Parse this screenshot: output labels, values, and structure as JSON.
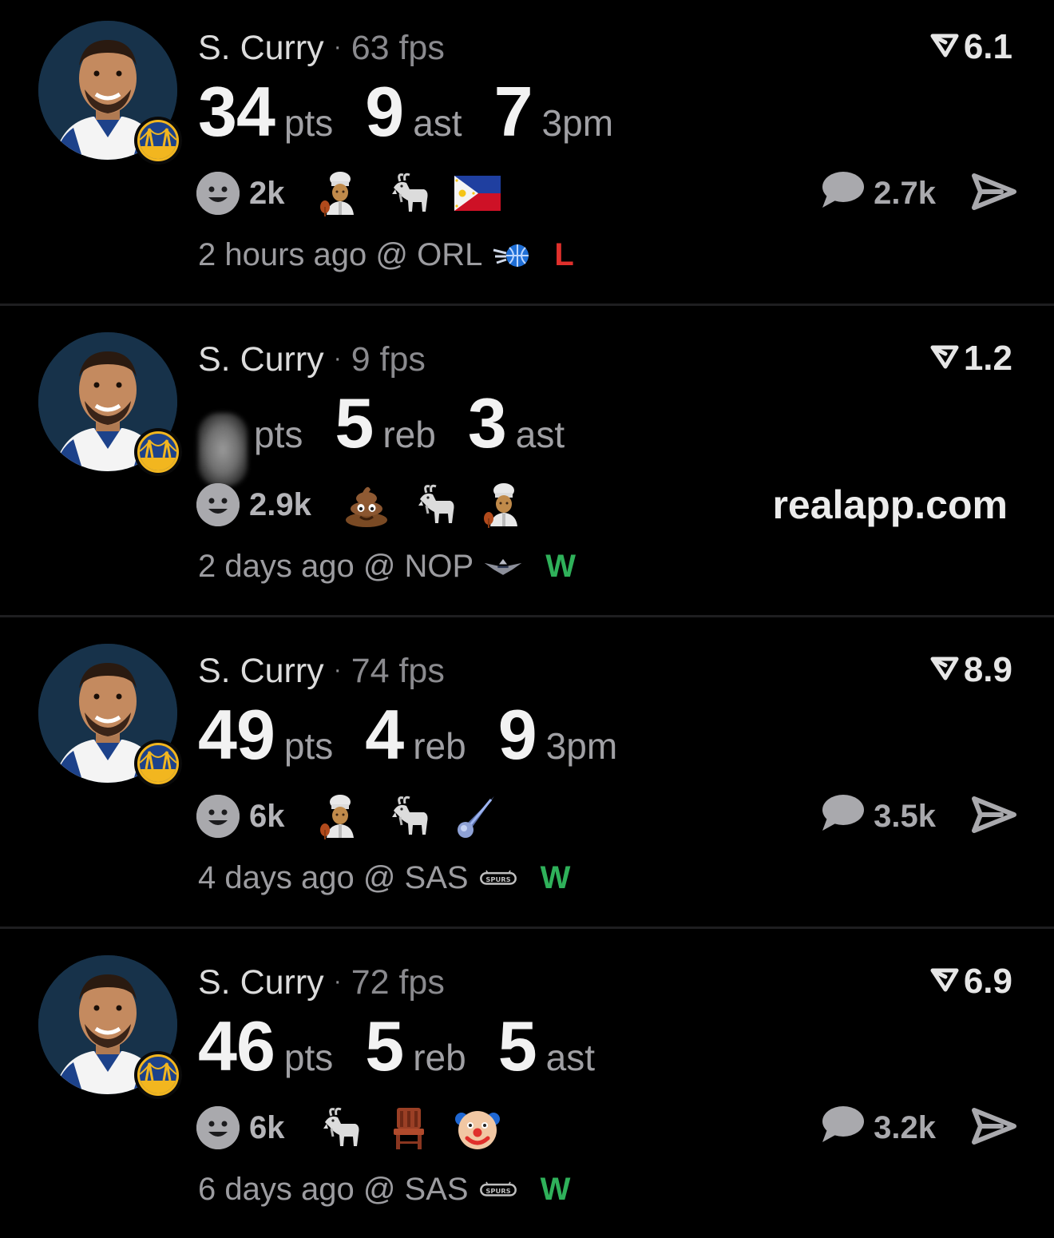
{
  "colors": {
    "background": "#000000",
    "loss": "#e0302c",
    "win": "#2fb15a",
    "muted": "#8a8a8e"
  },
  "watermark": "realapp.com",
  "posts": [
    {
      "player": "S. Curry",
      "separator": "·",
      "fps": "63 fps",
      "rating": "6.1",
      "stats": [
        {
          "num": "34",
          "label": "pts"
        },
        {
          "num": "9",
          "label": "ast"
        },
        {
          "num": "7",
          "label": "3pm"
        }
      ],
      "reaction_count": "2k",
      "emojis": [
        "cook-icon",
        "goat-icon",
        "philippines-flag-icon"
      ],
      "comment_count": "2.7k",
      "time": "2 hours ago @ ORL",
      "opponent_logo": "orl-logo-icon",
      "result": "L"
    },
    {
      "player": "S. Curry",
      "separator": "·",
      "fps": "9 fps",
      "rating": "1.2",
      "stats": [
        {
          "num": "",
          "label": "pts",
          "blurred": true
        },
        {
          "num": "5",
          "label": "reb"
        },
        {
          "num": "3",
          "label": "ast"
        }
      ],
      "reaction_count": "2.9k",
      "emojis": [
        "poop-icon",
        "goat-icon",
        "cook-icon"
      ],
      "comment_count": "",
      "time": "2 days ago @ NOP",
      "opponent_logo": "nop-logo-icon",
      "result": "W"
    },
    {
      "player": "S. Curry",
      "separator": "·",
      "fps": "74 fps",
      "rating": "8.9",
      "stats": [
        {
          "num": "49",
          "label": "pts"
        },
        {
          "num": "4",
          "label": "reb"
        },
        {
          "num": "9",
          "label": "3pm"
        }
      ],
      "reaction_count": "6k",
      "emojis": [
        "cook-icon",
        "goat-icon",
        "comet-icon"
      ],
      "comment_count": "3.5k",
      "time": "4 days ago @ SAS",
      "opponent_logo": "sas-logo-icon",
      "result": "W"
    },
    {
      "player": "S. Curry",
      "separator": "·",
      "fps": "72 fps",
      "rating": "6.9",
      "stats": [
        {
          "num": "46",
          "label": "pts"
        },
        {
          "num": "5",
          "label": "reb"
        },
        {
          "num": "5",
          "label": "ast"
        }
      ],
      "reaction_count": "6k",
      "emojis": [
        "goat-icon",
        "chair-icon",
        "clown-icon"
      ],
      "comment_count": "3.2k",
      "time": "6 days ago @ SAS",
      "opponent_logo": "sas-logo-icon",
      "result": "W"
    }
  ]
}
